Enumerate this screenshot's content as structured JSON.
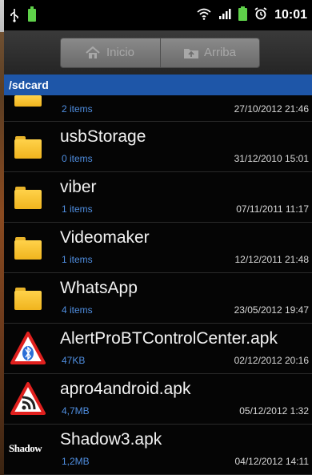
{
  "status": {
    "time": "10:01"
  },
  "toolbar": {
    "home_label": "Inicio",
    "up_label": "Arriba"
  },
  "path": "/sdcard",
  "files": [
    {
      "name": "",
      "meta": "2 items",
      "date": "27/10/2012 21:46",
      "icon": "folder-icon"
    },
    {
      "name": "usbStorage",
      "meta": "0 items",
      "date": "31/12/2010 15:01",
      "icon": "folder-icon"
    },
    {
      "name": "viber",
      "meta": "1 items",
      "date": "07/11/2011 11:17",
      "icon": "folder-icon"
    },
    {
      "name": "Videomaker",
      "meta": "1 items",
      "date": "12/12/2011 21:48",
      "icon": "folder-icon"
    },
    {
      "name": "WhatsApp",
      "meta": "4 items",
      "date": "23/05/2012 19:47",
      "icon": "folder-icon"
    },
    {
      "name": "AlertProBTControlCenter.apk",
      "meta": "47KB",
      "date": "02/12/2012 20:16",
      "icon": "bluetooth-warning-icon"
    },
    {
      "name": "apro4android.apk",
      "meta": "4,7MB",
      "date": "05/12/2012 1:32",
      "icon": "rss-warning-icon"
    },
    {
      "name": "Shadow3.apk",
      "meta": "1,2MB",
      "date": "04/12/2012 14:11",
      "icon": "shadow-logo-icon",
      "logo_text": "Shadow"
    }
  ],
  "colors": {
    "path_bar": "#1e56a8",
    "meta_text": "#4f8ee0",
    "folder": "#f0b41e"
  }
}
